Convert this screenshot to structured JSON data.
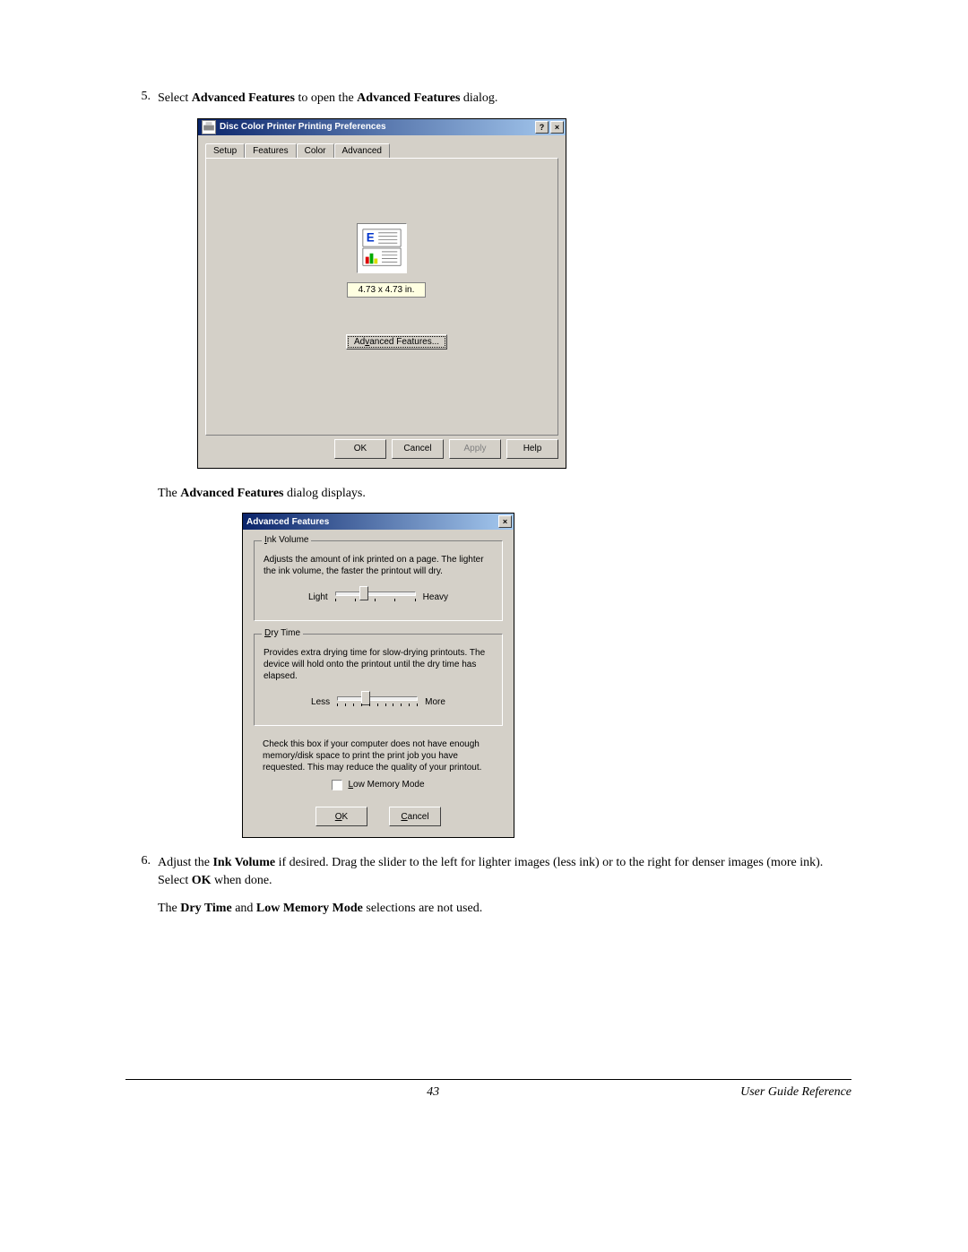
{
  "steps": {
    "s5": {
      "num": "5.",
      "text_pre": "Select ",
      "b1": "Advanced Features",
      "text_mid": " to open the ",
      "b2": "Advanced Features",
      "text_post": " dialog."
    },
    "sub5": {
      "pre": "The ",
      "b": "Advanced Features",
      "post": " dialog displays."
    },
    "s6": {
      "num": "6.",
      "pre": "Adjust the ",
      "b1": "Ink Volume",
      "mid1": " if desired. Drag the slider to the left for lighter images (less ink) or to the right for denser images (more ink).  Select ",
      "b2": "OK",
      "post": " when done."
    },
    "sub6": {
      "pre": "The ",
      "b1": "Dry Time",
      "mid": " and ",
      "b2": "Low Memory Mode",
      "post": " selections are not used."
    }
  },
  "dialog1": {
    "title": "Disc Color Printer Printing Preferences",
    "help_btn": "?",
    "close_btn": "×",
    "tabs": {
      "setup": "Setup",
      "features": "Features",
      "color": "Color",
      "advanced": "Advanced"
    },
    "size_label": "4.73 x 4.73 in.",
    "adv_btn_pre": "Ad",
    "adv_btn_u": "v",
    "adv_btn_post": "anced Features...",
    "buttons": {
      "ok": "OK",
      "cancel": "Cancel",
      "apply": "Apply",
      "help": "Help"
    }
  },
  "dialog2": {
    "title": "Advanced Features",
    "close_btn": "×",
    "ink": {
      "legend_u": "I",
      "legend_rest": "nk Volume",
      "desc": "Adjusts the amount of ink printed on a page. The lighter the ink volume, the faster the printout will dry.",
      "left": "Light",
      "right": "Heavy",
      "ticks": 5,
      "thumb_pct": 30
    },
    "dry": {
      "legend_u": "D",
      "legend_rest": "ry Time",
      "desc": "Provides extra drying time for slow-drying printouts. The device will hold onto the printout until the dry time has elapsed.",
      "left": "Less",
      "right": "More",
      "ticks": 11,
      "thumb_pct": 30
    },
    "mem": {
      "desc": "Check this box if your computer does not have enough memory/disk space to print the print job you have requested. This may reduce the quality of your printout.",
      "label_u": "L",
      "label_rest": "ow Memory Mode"
    },
    "buttons": {
      "ok_u": "O",
      "ok_rest": "K",
      "cancel_u": "C",
      "cancel_rest": "ancel"
    }
  },
  "footer": {
    "page": "43",
    "ref": "User Guide Reference"
  }
}
